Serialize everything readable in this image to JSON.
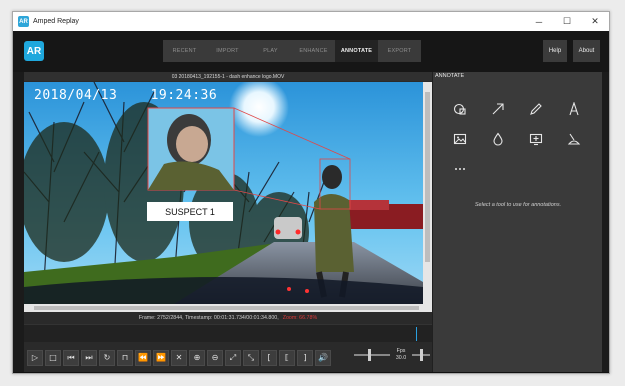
{
  "window": {
    "title": "Amped Replay",
    "app_icon_text": "AR",
    "minimize": "─",
    "maximize": "☐",
    "close": "✕"
  },
  "header": {
    "logo_text": "AR",
    "tabs": [
      {
        "label": "RECENT",
        "active": false
      },
      {
        "label": "IMPORT",
        "active": false
      },
      {
        "label": "PLAY",
        "active": false
      },
      {
        "label": "ENHANCE",
        "active": false
      },
      {
        "label": "ANNOTATE",
        "active": true
      },
      {
        "label": "EXPORT",
        "active": false
      }
    ],
    "help_label": "Help",
    "about_label": "About"
  },
  "video": {
    "file_title": "03 20180413_192155-1 - dash enhance logo.MOV",
    "timestamp_overlay": "2018/04/13    19:24:36",
    "annotation_label": "SUSPECT 1"
  },
  "status": {
    "frame_text": "Frame: 2752/2844, Timestamp: 00:01:31.734/00:01:34.800,",
    "zoom_text": "Zoom: 66.78%"
  },
  "controls": {
    "buttons": [
      {
        "name": "play-button",
        "glyph": "▷"
      },
      {
        "name": "stop-button",
        "glyph": "□"
      },
      {
        "name": "first-frame-button",
        "glyph": "⏮"
      },
      {
        "name": "last-frame-button",
        "glyph": "⏭"
      },
      {
        "name": "loop-button",
        "glyph": "↻"
      },
      {
        "name": "bookmark-button",
        "glyph": "⊓"
      },
      {
        "name": "rewind-button",
        "glyph": "⏪"
      },
      {
        "name": "fast-forward-button",
        "glyph": "⏩"
      },
      {
        "name": "clear-button",
        "glyph": "✕"
      },
      {
        "name": "zoom-in-button",
        "glyph": "⊕"
      },
      {
        "name": "zoom-out-button",
        "glyph": "⊖"
      },
      {
        "name": "fit-button",
        "glyph": "⤢"
      },
      {
        "name": "actual-size-button",
        "glyph": "⤡"
      },
      {
        "name": "mark-in-button",
        "glyph": "["
      },
      {
        "name": "clear-range-button",
        "glyph": "⟦"
      },
      {
        "name": "mark-out-button",
        "glyph": "]"
      },
      {
        "name": "volume-button",
        "glyph": "🔊"
      }
    ],
    "fps_label": "Fps",
    "fps_value": "30.0"
  },
  "annotate": {
    "title": "ANNOTATE",
    "hint": "Select a tool to use for annotations.",
    "tools": [
      "magnify-tool",
      "arrow-tool",
      "pencil-tool",
      "text-tool",
      "image-tool",
      "blur-drop-tool",
      "add-frame-tool",
      "spotlight-tool",
      "more-tools"
    ]
  },
  "colors": {
    "accent": "#1fa8dd",
    "annotation": "#e04848",
    "zoom_text": "#e03b3b"
  }
}
